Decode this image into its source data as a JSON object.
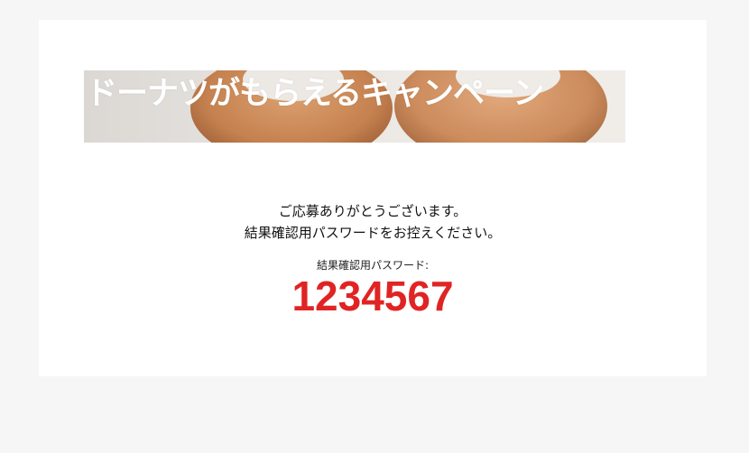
{
  "banner": {
    "title": "ドーナツがもらえるキャンペーン",
    "image_icon": "donut-photo"
  },
  "message": {
    "line1": "ご応募ありがとうございます。",
    "line2": "結果確認用パスワードをお控えください。"
  },
  "password": {
    "label": "結果確認用パスワード:",
    "value": "1234567"
  },
  "colors": {
    "page_background": "#f6f6f6",
    "card_background": "#ffffff",
    "password_red": "#e02424",
    "banner_title": "#ffffff"
  }
}
